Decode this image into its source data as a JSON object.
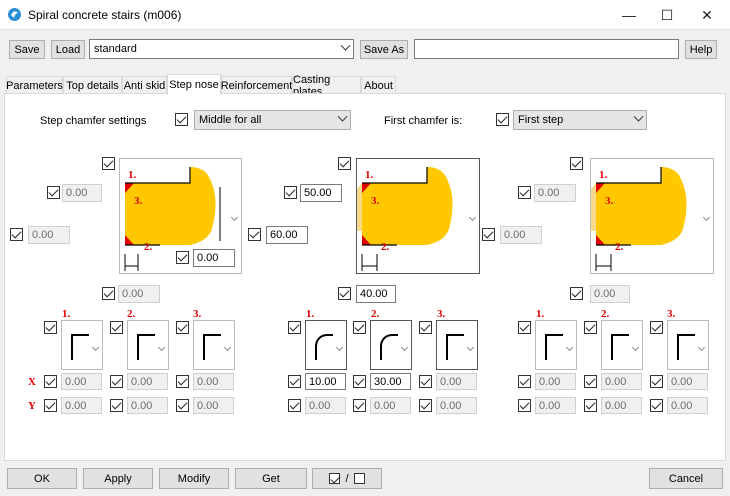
{
  "window": {
    "title": "Spiral concrete stairs (m006)",
    "minimize": "—",
    "maximize": "☐",
    "close": "✕",
    "icon": "app-logo-icon"
  },
  "toolbar": {
    "save": "Save",
    "load": "Load",
    "preset": "standard",
    "save_as": "Save As",
    "save_as_name": "",
    "help": "Help"
  },
  "tabs": [
    "Parameters",
    "Top details",
    "Anti skid",
    "Step nose",
    "Reinforcement",
    "Casting plates",
    "About"
  ],
  "settings": {
    "step_chamfer_label": "Step chamfer settings",
    "step_chamfer_value": "Middle for all",
    "first_chamfer_label": "First chamfer is:",
    "first_chamfer_value": "First step"
  },
  "markers": {
    "one": "1.",
    "two": "2.",
    "three": "3.",
    "x": "X",
    "y": "Y"
  },
  "left": {
    "top_left": "0.00",
    "mid_left": "0.00",
    "right": "0.00",
    "bottom": "0.00",
    "x1": "0.00",
    "x2": "0.00",
    "x3": "0.00",
    "y1": "0.00",
    "y2": "0.00",
    "y3": "0.00"
  },
  "middle": {
    "top_left": "50.00",
    "mid_left": "60.00",
    "bottom": "40.00",
    "x1": "10.00",
    "x2": "30.00",
    "x3": "0.00",
    "y1": "0.00",
    "y2": "0.00",
    "y3": "0.00"
  },
  "right": {
    "top_left": "0.00",
    "mid_left": "0.00",
    "bottom": "0.00",
    "x1": "0.00",
    "x2": "0.00",
    "x3": "0.00",
    "y1": "0.00",
    "y2": "0.00",
    "y3": "0.00"
  },
  "bottom": {
    "ok": "OK",
    "apply": "Apply",
    "modify": "Modify",
    "get": "Get",
    "toggle": "/",
    "cancel": "Cancel"
  },
  "colors": {
    "yellow": "#ffc800",
    "light_yellow": "#f7d98a",
    "red": "#e00000"
  }
}
